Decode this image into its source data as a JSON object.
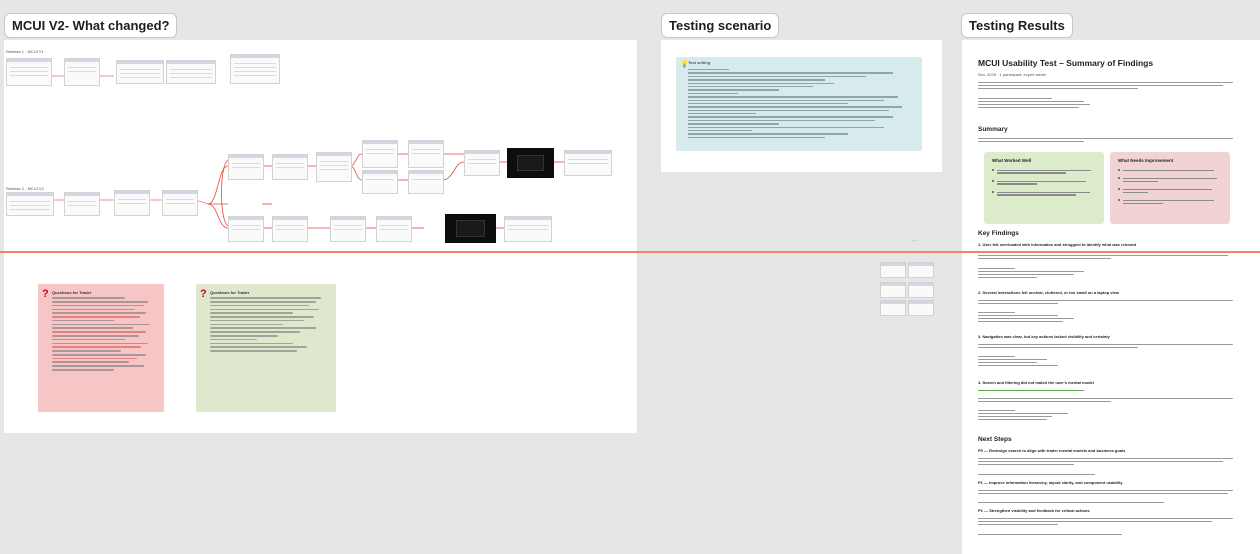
{
  "frames": {
    "what_changed": "MCUI V2- What changed?",
    "testing_scenario": "Testing scenario",
    "testing_results": "Testing Results"
  },
  "flow": {
    "label_top": "Release 1 - MCUI V1",
    "label_middle": "Release 2 - MCUI V2"
  },
  "scenario": {
    "icon": "lightbulb-icon",
    "heading": "Test setting"
  },
  "notes": {
    "red_icon": "question-icon",
    "red_title": "Questions for Trader",
    "green_icon": "question-icon",
    "green_title": "Questions for Trader"
  },
  "results": {
    "title": "MCUI Usability Test – Summary of Findings",
    "meta": "Nov, 2025 · 1 participant, expert trader",
    "summary_heading": "Summary",
    "worked_title": "What Worked Well",
    "worked_items": [
      "Overall flow was understandable. The user generally knew where to go next.",
      "Returning to previous tabs after completing a step felt natural.",
      "Some components, such as the receipt dropdown, gave users confidence in their changes."
    ],
    "needs_title": "What Needs Improvement",
    "needs_items": [
      "Reduce noise and emphasize relevant information.",
      "Improve spacing, hierarchy, and component visibility.",
      "Strengthen confirmation and feedback for critical actions.",
      "Redesign search around trader workflows, not system structures."
    ],
    "findings_heading": "Key Findings",
    "finding_1": "1. User felt overloaded with information and struggled to identify what was relevant",
    "finding_2": "2. Several interactions felt unclear, cluttered, or too small on a laptop view",
    "finding_3": "3. Navigation was clear, but key actions lacked visibility and certainty",
    "finding_4": "4. Search and filtering did not match the user's mental model",
    "next_heading": "Next Steps",
    "p0": "P0 — Redesign search to align with trader mental models and business goals",
    "p1a": "P1 — Improve information hierarchy, layout clarity, and component usability",
    "p1b": "P1 — Strengthen visibility and feedback for critical actions"
  },
  "colors": {
    "canvas": "#e6e6e6",
    "sticky_red": "#f6c6c6",
    "sticky_green": "#dde8cc",
    "callout_teal": "#d7ebec",
    "divider": "#f0806f",
    "worked_bg": "#dcebc9",
    "needs_bg": "#f2d3d3"
  }
}
